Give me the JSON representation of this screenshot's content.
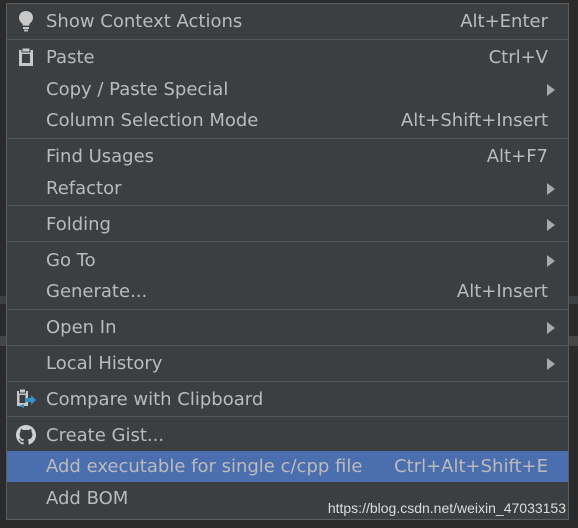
{
  "colors": {
    "menu_background": "#3c3f41",
    "selection": "#4b6eaf",
    "text": "#bbbbbb",
    "separator": "#515658"
  },
  "menu": {
    "items": [
      {
        "label": "Show Context Actions",
        "shortcut": "Alt+Enter",
        "icon": "lightbulb-icon"
      },
      {
        "label": "Paste",
        "shortcut": "Ctrl+V",
        "icon": "clipboard-icon"
      },
      {
        "label": "Copy / Paste Special",
        "shortcut": "",
        "submenu": true
      },
      {
        "label": "Column Selection Mode",
        "shortcut": "Alt+Shift+Insert"
      },
      {
        "label": "Find Usages",
        "shortcut": "Alt+F7"
      },
      {
        "label": "Refactor",
        "shortcut": "",
        "submenu": true
      },
      {
        "label": "Folding",
        "shortcut": "",
        "submenu": true
      },
      {
        "label": "Go To",
        "shortcut": "",
        "submenu": true
      },
      {
        "label": "Generate...",
        "shortcut": "Alt+Insert"
      },
      {
        "label": "Open In",
        "shortcut": "",
        "submenu": true
      },
      {
        "label": "Local History",
        "shortcut": "",
        "submenu": true
      },
      {
        "label": "Compare with Clipboard",
        "shortcut": "",
        "icon": "compare-clipboard-icon"
      },
      {
        "label": "Create Gist...",
        "shortcut": "",
        "icon": "github-icon"
      },
      {
        "label": "Add executable for single c/cpp file",
        "shortcut": "Ctrl+Alt+Shift+E",
        "selected": true
      },
      {
        "label": "Add BOM",
        "shortcut": ""
      }
    ]
  },
  "watermark": "https://blog.csdn.net/weixin_47033153"
}
